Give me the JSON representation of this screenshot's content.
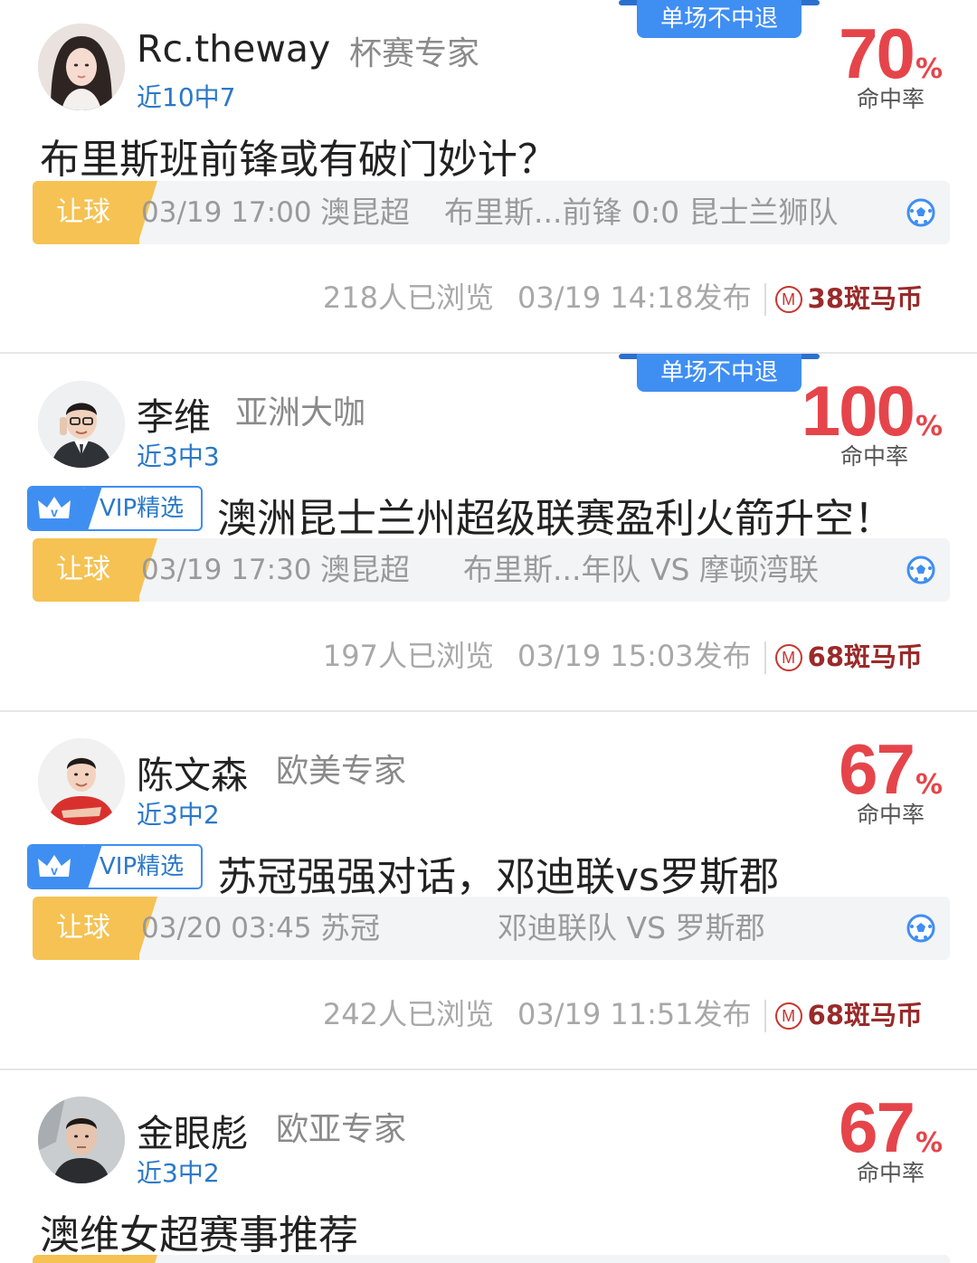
{
  "rate_label": "命中率",
  "percent_sign": "%",
  "refund_tag": "单场不中退",
  "vip_label": "VIP精选",
  "coin_symbol": "M",
  "cards": [
    {
      "name": "Rc.theway",
      "rank": "杯赛专家",
      "record": "近10中7",
      "rate": "70",
      "title": "布里斯班前锋或有破门妙计？",
      "match": {
        "type": "让球",
        "time": "03/19 17:00",
        "league": "澳昆超",
        "teams": "布里斯...前锋   0:0  昆士兰狮队"
      },
      "views": "218人已浏览",
      "published": "03/19 14:18发布",
      "price": "38斑马币"
    },
    {
      "name": "李维",
      "rank": "亚洲大咖",
      "record": "近3中3",
      "rate": "100",
      "title": "澳洲昆士兰州超级联赛盈利火箭升空！",
      "match": {
        "type": "让球",
        "time": "03/19 17:30",
        "league": "澳昆超",
        "teams": "布里斯...年队  VS  摩顿湾联"
      },
      "views": "197人已浏览",
      "published": "03/19 15:03发布",
      "price": "68斑马币"
    },
    {
      "name": "陈文森",
      "rank": "欧美专家",
      "record": "近3中2",
      "rate": "67",
      "title": "苏冠强强对话，邓迪联vs罗斯郡",
      "match": {
        "type": "让球",
        "time": "03/20 03:45",
        "league": "苏冠",
        "teams": "邓迪联队  VS  罗斯郡"
      },
      "views": "242人已浏览",
      "published": "03/19 11:51发布",
      "price": "68斑马币"
    },
    {
      "name": "金眼彪",
      "rank": "欧亚专家",
      "record": "近3中2",
      "rate": "67",
      "title": "澳维女超赛事推荐"
    }
  ]
}
